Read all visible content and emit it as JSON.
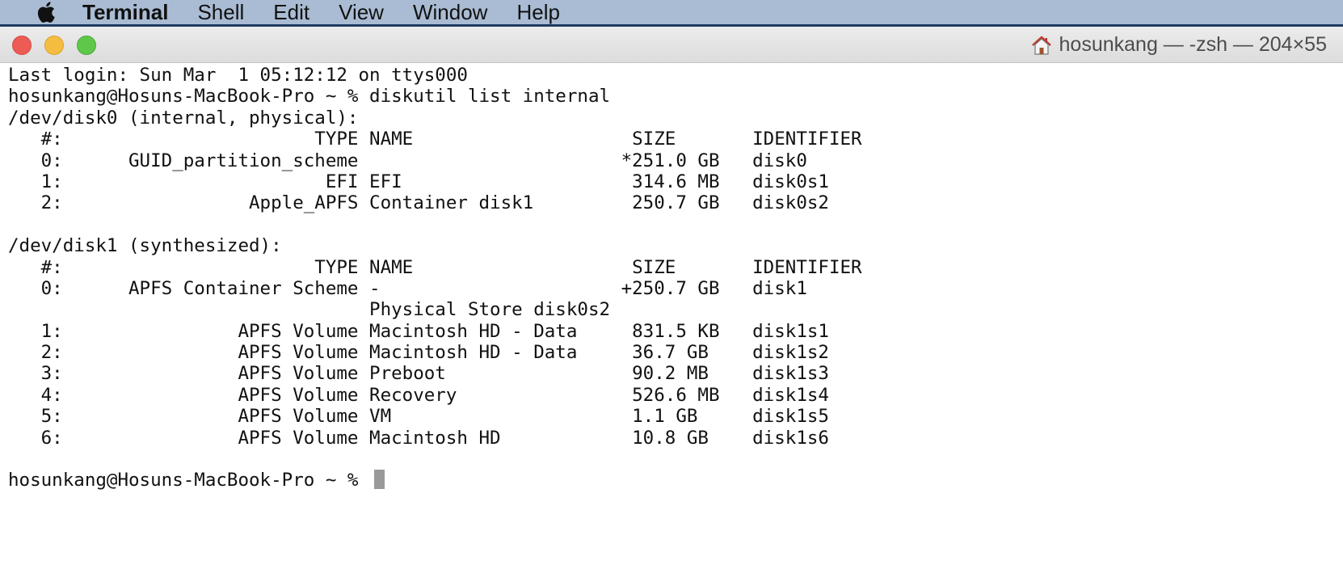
{
  "menubar": {
    "apple_icon": "apple-logo-icon",
    "app_name": "Terminal",
    "items": [
      "Shell",
      "Edit",
      "View",
      "Window",
      "Help"
    ]
  },
  "window": {
    "title": "hosunkang — -zsh — 204×55",
    "title_icon": "home-icon",
    "controls": {
      "close_color": "#ee5b55",
      "minimize_color": "#f5bd3f",
      "zoom_color": "#5fc84a"
    }
  },
  "terminal": {
    "lines": [
      "Last login: Sun Mar  1 05:12:12 on ttys000",
      "hosunkang@Hosuns-MacBook-Pro ~ % diskutil list internal",
      "/dev/disk0 (internal, physical):",
      "   #:                       TYPE NAME                    SIZE       IDENTIFIER",
      "   0:      GUID_partition_scheme                        *251.0 GB   disk0",
      "   1:                        EFI EFI                     314.6 MB   disk0s1",
      "   2:                 Apple_APFS Container disk1         250.7 GB   disk0s2",
      "",
      "/dev/disk1 (synthesized):",
      "   #:                       TYPE NAME                    SIZE       IDENTIFIER",
      "   0:      APFS Container Scheme -                      +250.7 GB   disk1",
      "                                 Physical Store disk0s2",
      "   1:                APFS Volume Macintosh HD - Data     831.5 KB   disk1s1",
      "   2:                APFS Volume Macintosh HD - Data     36.7 GB    disk1s2",
      "   3:                APFS Volume Preboot                 90.2 MB    disk1s3",
      "   4:                APFS Volume Recovery                526.6 MB   disk1s4",
      "   5:                APFS Volume VM                      1.1 GB     disk1s5",
      "   6:                APFS Volume Macintosh HD            10.8 GB    disk1s6",
      "",
      "hosunkang@Hosuns-MacBook-Pro ~ % "
    ]
  }
}
